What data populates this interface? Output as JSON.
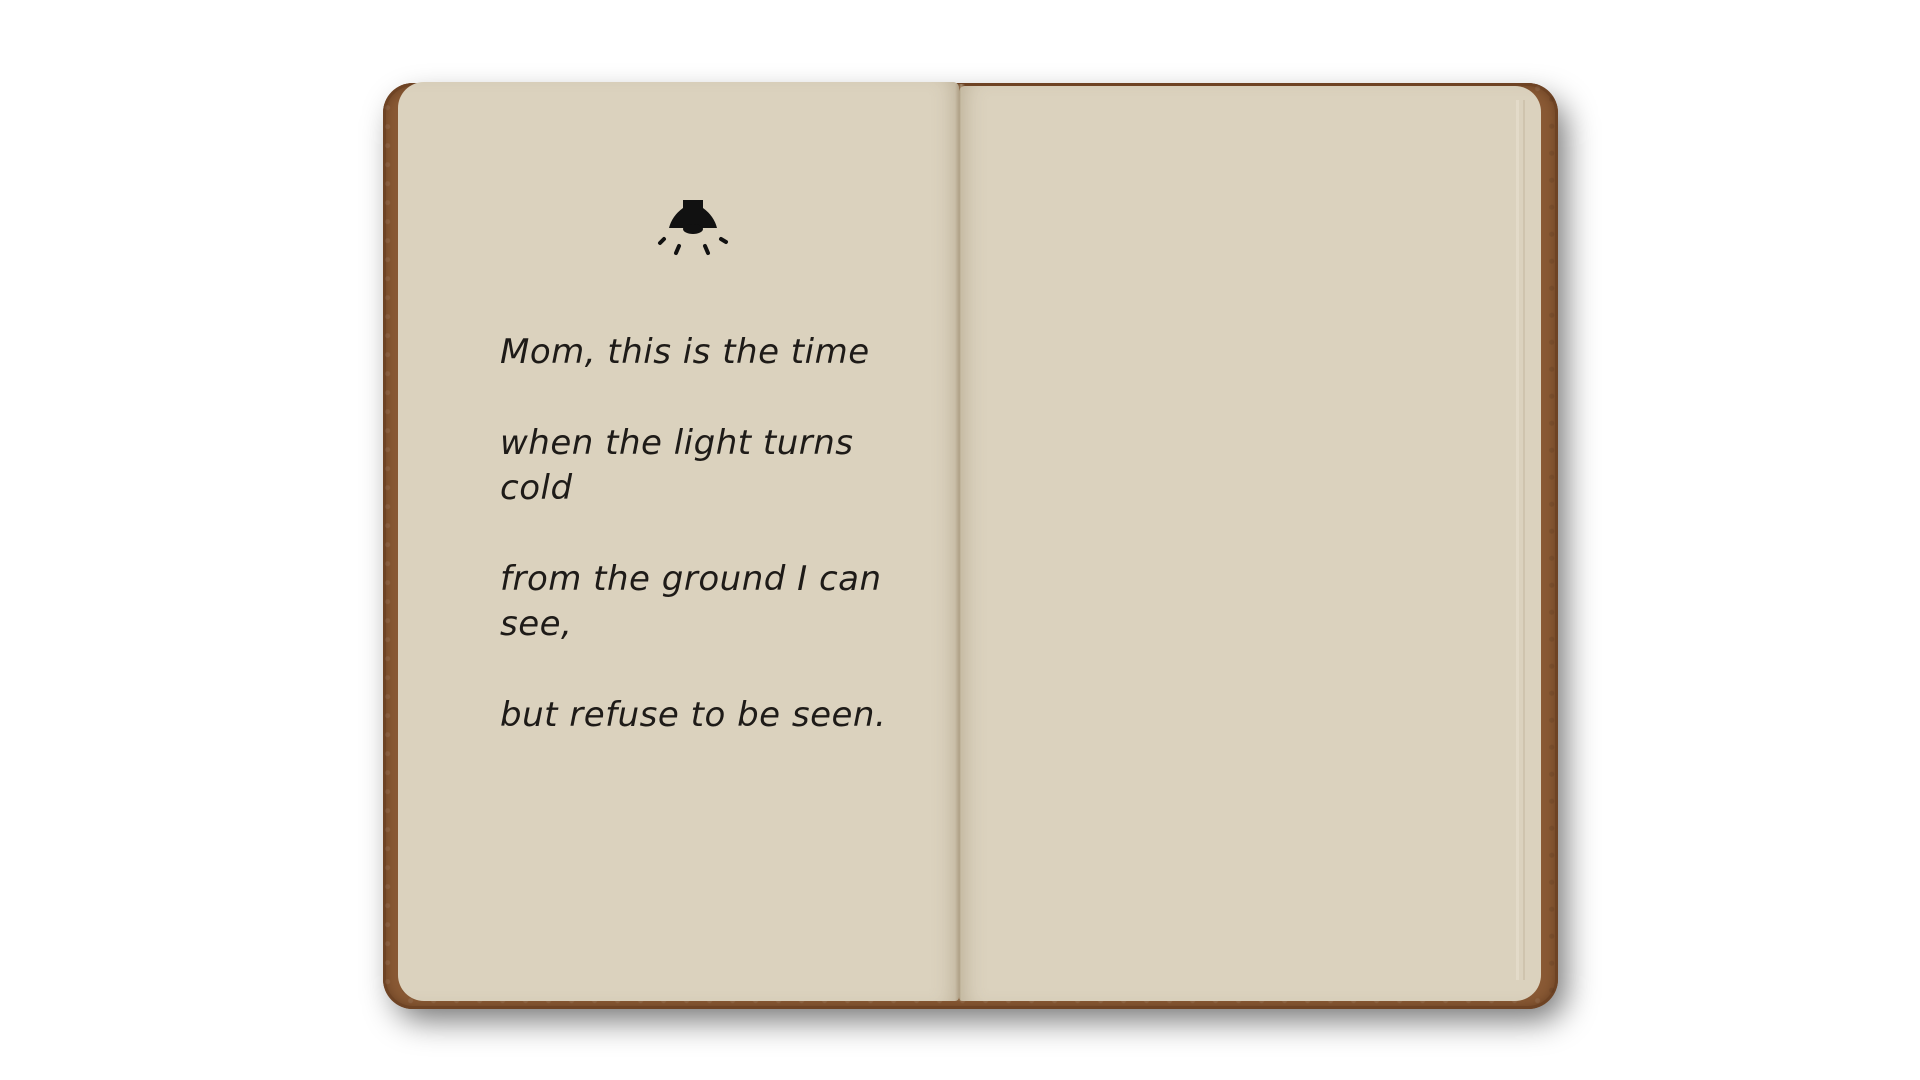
{
  "colors": {
    "background": "#ffffff",
    "cover": "#8a5a35",
    "page": "#dbd2be",
    "ink": "#1e1b18"
  },
  "notebook": {
    "icon": "ceiling-lamp-icon",
    "poem": [
      "Mom, this is the time",
      "when the light turns cold",
      "from the ground I can see,",
      "but refuse to be seen."
    ]
  }
}
